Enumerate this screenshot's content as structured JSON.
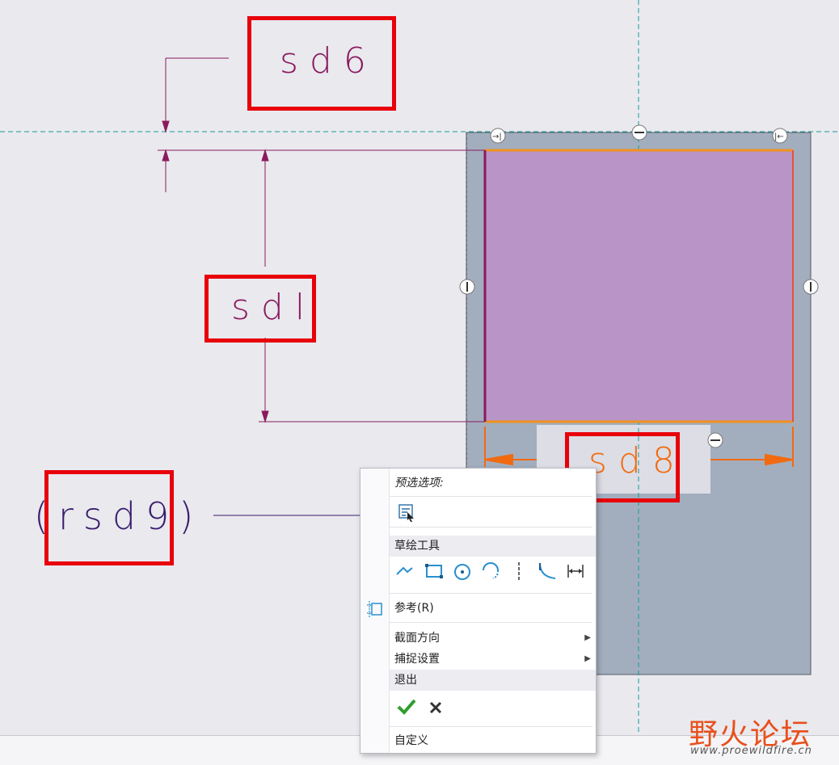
{
  "dimensions": {
    "sd6": "sd6",
    "sd1": "sdl",
    "sd8": "sd8",
    "rsd9": "(rsd9)"
  },
  "context_menu": {
    "preselect_label": "预选选项:",
    "sketch_tools_label": "草绘工具",
    "reference_label": "参考(R)",
    "section_orientation_label": "截面方向",
    "snap_settings_label": "捕捉设置",
    "exit_label": "退出",
    "customize_label": "自定义",
    "icons": {
      "filter": "filter-select-icon",
      "line": "line-chain-icon",
      "rectangle": "rectangle-icon",
      "circle": "circle-icon",
      "arc": "arc-icon",
      "centerline": "centerline-icon",
      "fillet": "fillet-icon",
      "dimension": "dimension-icon",
      "reference": "reference-icon",
      "accept": "checkmark-icon",
      "cancel": "x-icon"
    }
  },
  "watermark": {
    "title": "野火论坛",
    "url": "www.proewildfire.cn"
  },
  "colors": {
    "background": "#e9e9ee",
    "sketch_fill": "#b994c6",
    "sheet_gray": "#a2aebe",
    "dimension_purple": "#8b1a5e",
    "dimension_orange": "#f26a10",
    "annot_red": "#e8000b",
    "centerline_teal": "#1a9b9b"
  }
}
